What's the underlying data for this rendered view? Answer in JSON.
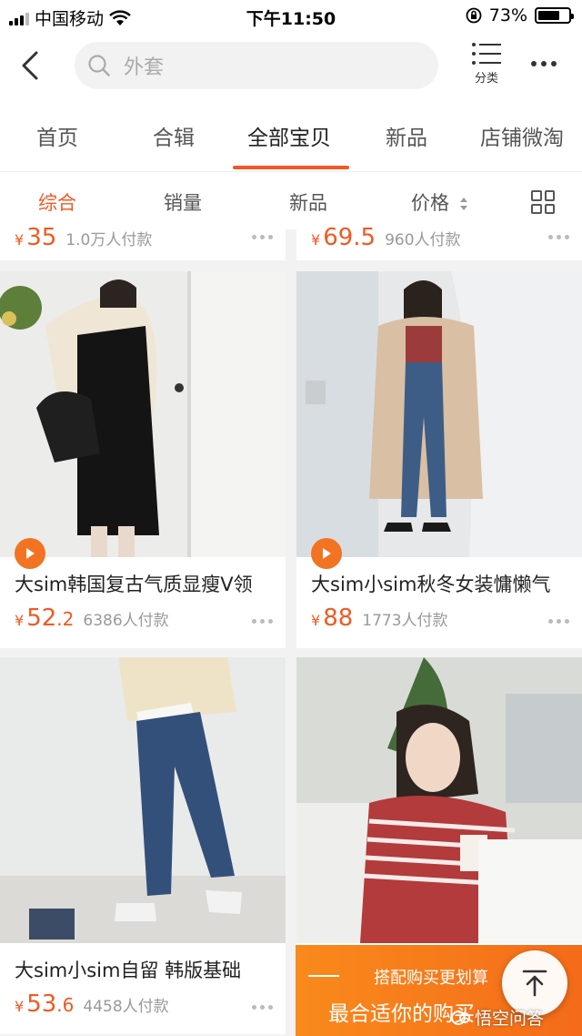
{
  "status_bar": {
    "carrier": "中国移动",
    "time": "下午11:50",
    "battery_percent": "73%",
    "battery_level": 0.73
  },
  "search": {
    "placeholder": "外套",
    "category_label": "分类"
  },
  "shop_tabs": [
    {
      "label": "首页",
      "active": false
    },
    {
      "label": "合辑",
      "active": false
    },
    {
      "label": "全部宝贝",
      "active": true
    },
    {
      "label": "新品",
      "active": false
    },
    {
      "label": "店铺微淘",
      "active": false
    }
  ],
  "sort_bar": {
    "items": [
      {
        "label": "综合",
        "active": true
      },
      {
        "label": "销量",
        "active": false
      },
      {
        "label": "新品",
        "active": false
      },
      {
        "label": "价格",
        "active": false
      }
    ]
  },
  "prev_row": [
    {
      "yen": "¥",
      "price_int": "35",
      "price_dec": "",
      "sold": "1.0万人付款"
    },
    {
      "yen": "¥",
      "price_int": "69.5",
      "price_dec": "",
      "sold": "960人付款"
    }
  ],
  "products": [
    {
      "title": "大sim韩国复古气质显瘦V领",
      "yen": "¥",
      "price_int": "52",
      "price_dec": ".2",
      "sold": "6386人付款",
      "has_video": true
    },
    {
      "title": "大sim小sim秋冬女装慵懒气",
      "yen": "¥",
      "price_int": "88",
      "price_dec": "",
      "sold": "1773人付款",
      "has_video": true
    },
    {
      "title": "大sim小sim自留 韩版基础",
      "yen": "¥",
      "price_int": "53",
      "price_dec": ".6",
      "sold": "4458人付款",
      "has_video": false
    }
  ],
  "promo": {
    "line1": "搭配购买更划算",
    "line2": "最合适你的购买"
  },
  "watermark": "悟空问答",
  "colors": {
    "accent": "#f05a22",
    "promo": "#f98a1b"
  }
}
